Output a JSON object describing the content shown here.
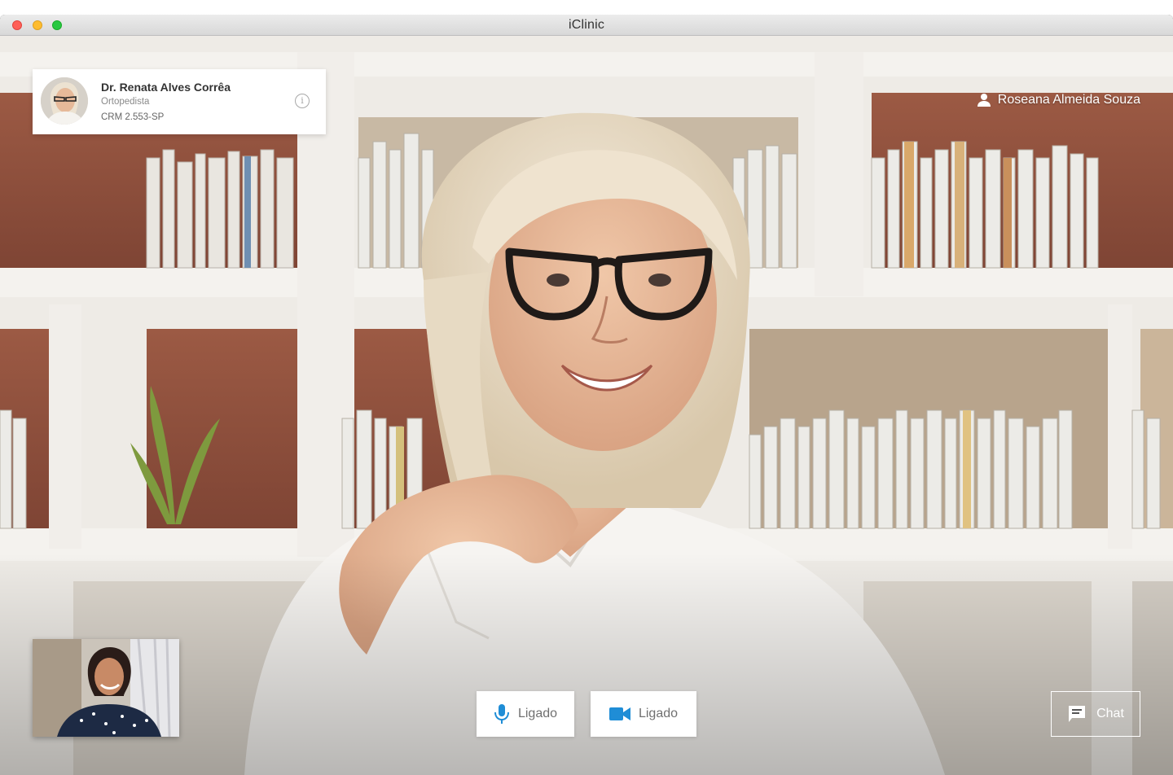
{
  "window": {
    "title": "iClinic"
  },
  "doctor": {
    "name": "Dr. Renata Alves Corrêa",
    "specialty": "Ortopedista",
    "crm": "CRM 2.553-SP",
    "info_icon": "info-icon"
  },
  "patient": {
    "name": "Roseana Almeida Souza",
    "icon": "user-icon"
  },
  "controls": {
    "mic": {
      "label": "Ligado",
      "icon": "microphone-icon"
    },
    "camera": {
      "label": "Ligado",
      "icon": "video-camera-icon"
    },
    "chat": {
      "label": "Chat",
      "icon": "chat-icon"
    }
  },
  "colors": {
    "accent": "#1f8dd6",
    "titlebar": "#e4e4e4"
  }
}
